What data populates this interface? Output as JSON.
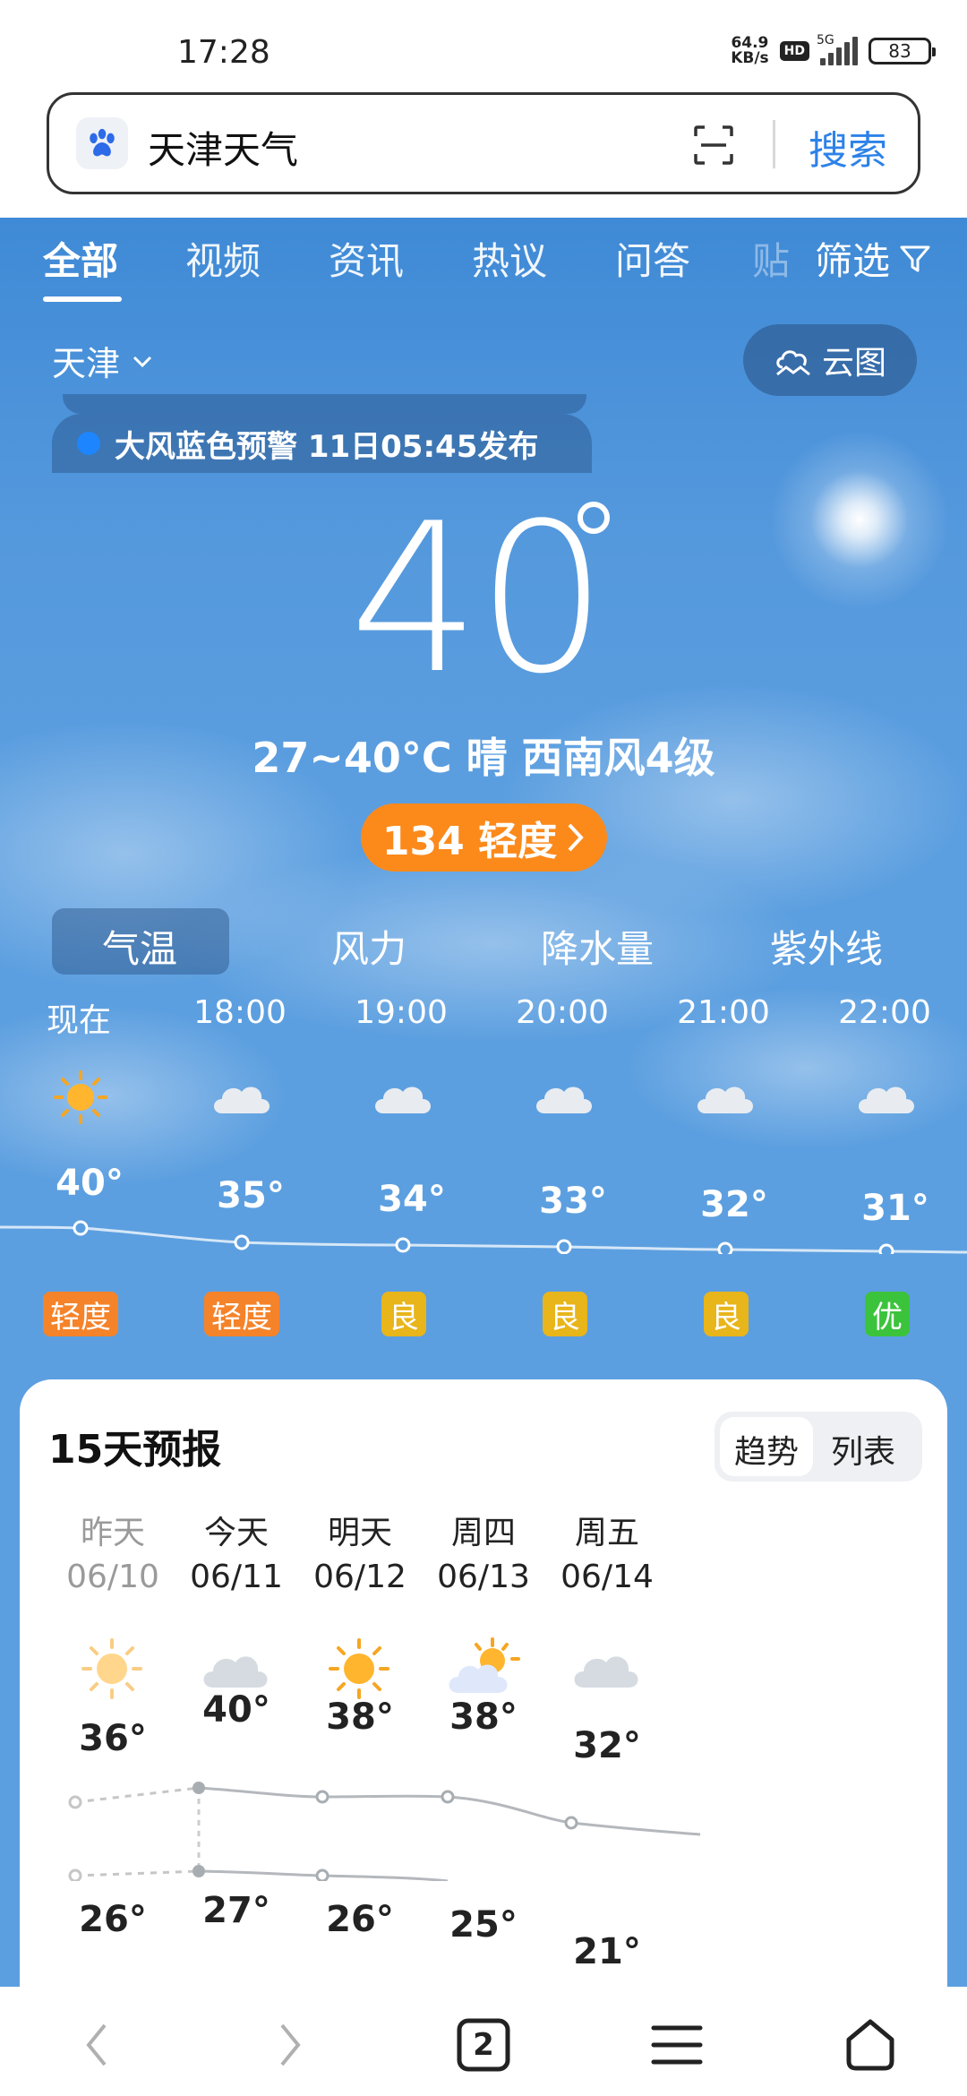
{
  "status": {
    "time": "17:28",
    "speed_value": "64.9",
    "speed_unit": "KB/s",
    "hd": "HD",
    "network": "5G",
    "battery": "83"
  },
  "search": {
    "query": "天津天气",
    "button": "搜索"
  },
  "tabs": [
    "全部",
    "视频",
    "资讯",
    "热议",
    "问答"
  ],
  "tab_more": "贴",
  "filter_label": "筛选",
  "location": {
    "city": "天津",
    "cloud_map": "云图"
  },
  "alert": {
    "text": "大风蓝色预警 11日05:45发布"
  },
  "current": {
    "temp": "40",
    "summary": "27~40°C 晴 西南风4级",
    "aqi": "134 轻度"
  },
  "metric_tabs": [
    "气温",
    "风力",
    "降水量",
    "紫外线"
  ],
  "hourly": [
    {
      "time": "现在",
      "icon": "sun-icon",
      "temp": "40°",
      "aqi": "轻度",
      "aqi_color": "#f5832a"
    },
    {
      "time": "18:00",
      "icon": "cloud-icon",
      "temp": "35°",
      "aqi": "轻度",
      "aqi_color": "#f5832a"
    },
    {
      "time": "19:00",
      "icon": "cloud-icon",
      "temp": "34°",
      "aqi": "良",
      "aqi_color": "#e8b51a"
    },
    {
      "time": "20:00",
      "icon": "cloud-icon",
      "temp": "33°",
      "aqi": "良",
      "aqi_color": "#e8b51a"
    },
    {
      "time": "21:00",
      "icon": "cloud-icon",
      "temp": "32°",
      "aqi": "良",
      "aqi_color": "#e8b51a"
    },
    {
      "time": "22:00",
      "icon": "cloud-icon",
      "temp": "31°",
      "aqi": "优",
      "aqi_color": "#3cc33c"
    }
  ],
  "forecast": {
    "title": "15天预报",
    "view_trend": "趋势",
    "view_list": "列表",
    "days": [
      {
        "day": "昨天",
        "date": "06/10",
        "icon": "sun-icon",
        "high": "36°",
        "low": "26°",
        "muted": true
      },
      {
        "day": "今天",
        "date": "06/11",
        "icon": "cloud-icon",
        "high": "40°",
        "low": "27°",
        "muted": false
      },
      {
        "day": "明天",
        "date": "06/12",
        "icon": "sun-icon",
        "high": "38°",
        "low": "26°",
        "muted": false
      },
      {
        "day": "周四",
        "date": "06/13",
        "icon": "partly-cloudy-icon",
        "high": "38°",
        "low": "25°",
        "muted": false
      },
      {
        "day": "周五",
        "date": "06/14",
        "icon": "cloud-icon",
        "high": "32°",
        "low": "21°",
        "muted": false
      }
    ]
  },
  "nav": {
    "tab_count": "2"
  }
}
